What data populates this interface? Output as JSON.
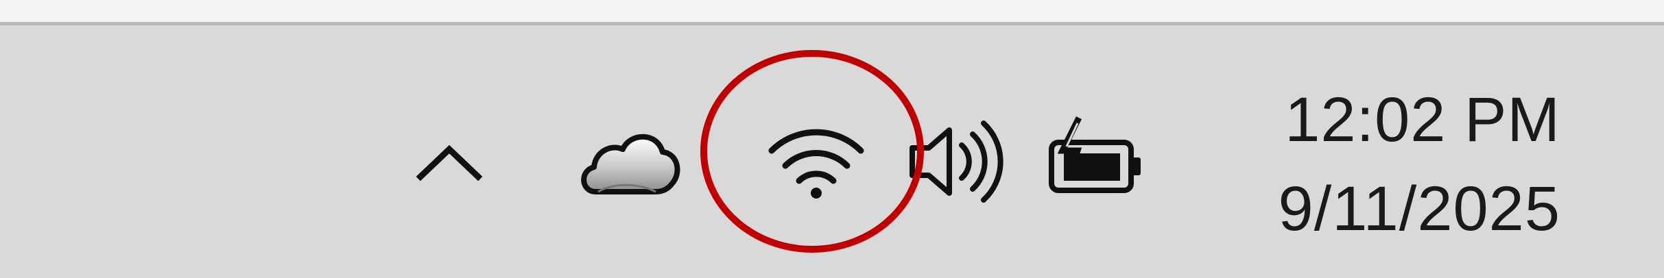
{
  "taskbar": {
    "tray": {
      "chevron": {
        "icon": "chevron-up-icon",
        "label": ""
      },
      "onedrive": {
        "icon": "cloud-icon"
      },
      "network": {
        "icon": "wifi-icon"
      },
      "volume": {
        "icon": "speaker-icon"
      },
      "battery": {
        "icon": "battery-charging-icon"
      }
    },
    "clock": {
      "time": "12:02 PM",
      "date": "9/11/2025"
    },
    "annotation": {
      "shape": "ellipse",
      "target": "wifi-icon",
      "color": "#c00000"
    }
  }
}
